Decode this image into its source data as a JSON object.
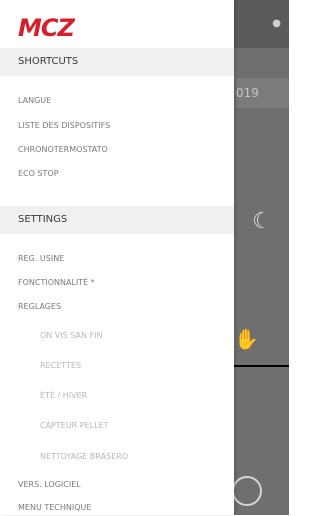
{
  "brand": {
    "name": "MCZ",
    "color": "#d51f2a"
  },
  "background": {
    "year_text": "019",
    "moon_icon": "moon-sleep-icon",
    "hand_icon": "hand-icon",
    "power_icon": "circle-icon",
    "dot_icon": "dot-icon"
  },
  "drawer": {
    "shortcuts_header": "SHORTCUTS",
    "shortcuts": [
      {
        "label": "LANGUE"
      },
      {
        "label": "LISTE DES DISPOSITIFS"
      },
      {
        "label": "CHRONOTERMOSTATO"
      },
      {
        "label": "ECO STOP"
      }
    ],
    "settings_header": "SETTINGS",
    "settings": [
      {
        "label": "REG. USINE"
      },
      {
        "label": "FONCTIONNALITÉ *"
      },
      {
        "label": "REGLAGES"
      },
      {
        "label": "ON VIS SAN FIN"
      },
      {
        "label": "RECETTES"
      },
      {
        "label": "ÉTÉ / HIVER"
      },
      {
        "label": "CAPTEUR PELLET"
      },
      {
        "label": "NETTOYAGE BRASERO"
      },
      {
        "label": "VERS. LOGICIEL"
      },
      {
        "label": "MENU TECHNIQUE"
      }
    ]
  },
  "colors": {
    "header_bg": "#f0f0f0",
    "item_text": "#7a7a7a",
    "subitem_text": "#b8b8b8",
    "overlay": "#6f6f6f"
  }
}
